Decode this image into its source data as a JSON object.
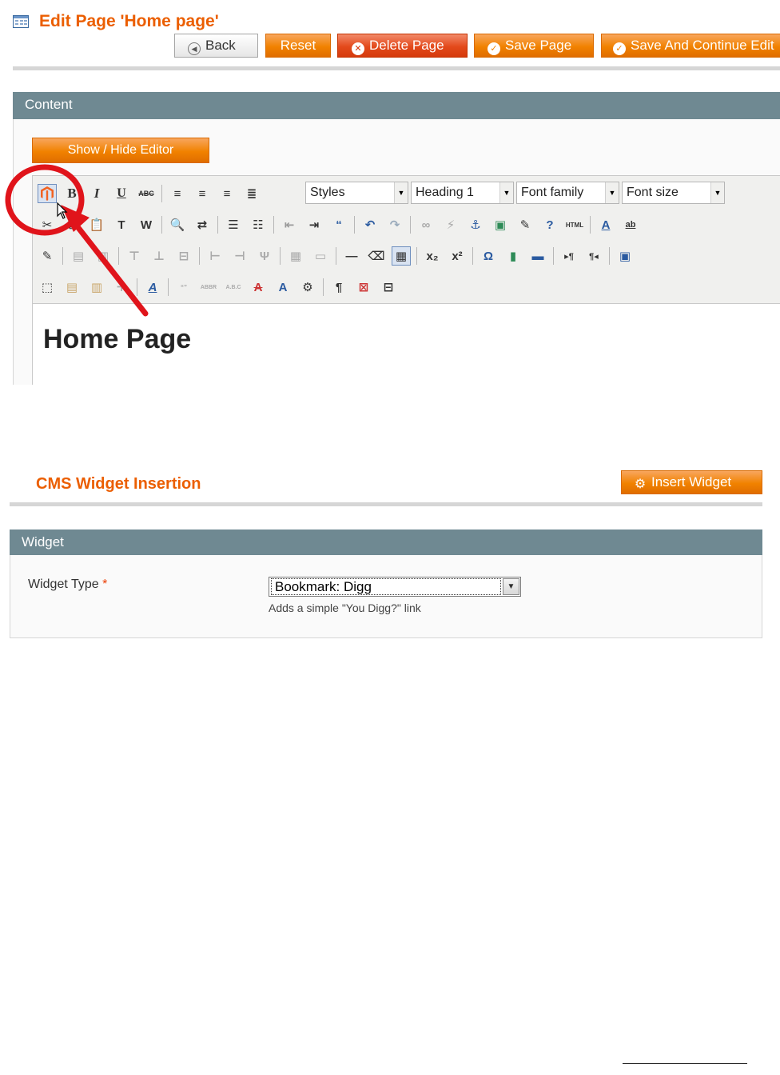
{
  "page": {
    "title": "Edit Page 'Home page'",
    "buttons": {
      "back": "Back",
      "reset": "Reset",
      "delete": "Delete Page",
      "save": "Save Page",
      "save_continue": "Save And Continue Edit"
    }
  },
  "content": {
    "section_title": "Content",
    "toggle_editor": "Show / Hide Editor",
    "toolbar": {
      "styles": "Styles",
      "format": "Heading 1",
      "font_family": "Font family",
      "font_size": "Font size"
    },
    "editor_heading": "Home Page"
  },
  "widget_insertion": {
    "title": "CMS Widget Insertion",
    "insert_button": "Insert Widget",
    "section_title": "Widget",
    "type_label": "Widget Type",
    "required_mark": "*",
    "type_value": "Bookmark: Digg",
    "type_note": "Adds a simple \"You Digg?\" link"
  },
  "colors": {
    "accent": "#eb5e00",
    "button_orange": "#f18200",
    "section_header": "#6f8992",
    "annotation_red": "#e0141b"
  },
  "icons": [
    "page-grid-icon",
    "back-arrow-icon",
    "delete-x-icon",
    "check-icon",
    "gear-icon",
    "magento-logo-icon"
  ]
}
